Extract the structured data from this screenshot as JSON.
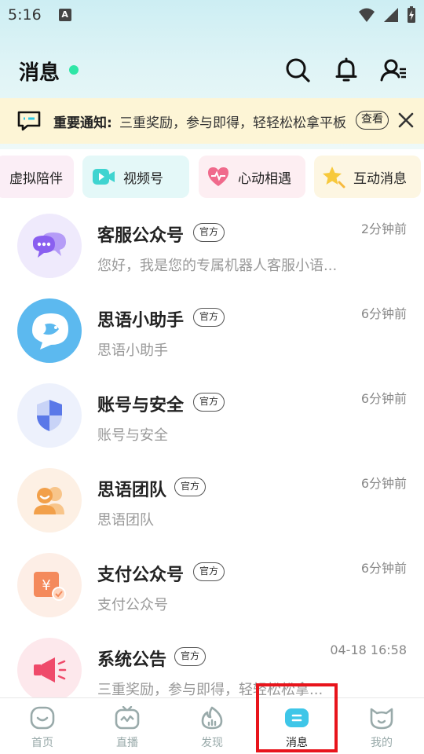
{
  "status_bar": {
    "time": "5:16",
    "badge": "A"
  },
  "header": {
    "title": "消息"
  },
  "notice": {
    "label": "重要通知:",
    "text": "三重奖励，参与即得，轻轻松松拿平板",
    "view_label": "查看"
  },
  "quick_tabs": [
    {
      "label": "虚拟陪伴",
      "icon": "virtual-companion-icon"
    },
    {
      "label": "视频号",
      "icon": "video-channel-icon"
    },
    {
      "label": "心动相遇",
      "icon": "heart-meet-icon"
    },
    {
      "label": "互动消息",
      "icon": "interaction-star-icon"
    }
  ],
  "official_tag": "官方",
  "messages": [
    {
      "title": "客服公众号",
      "time": "2分钟前",
      "preview": "您好，我是您的专属机器人客服小语...",
      "icon": "chat-bubbles-icon",
      "color": "#8a63f0"
    },
    {
      "title": "思语小助手",
      "time": "6分钟前",
      "preview": "思语小助手",
      "icon": "assistant-bird-icon",
      "color": "#5fb8ee"
    },
    {
      "title": "账号与安全",
      "time": "6分钟前",
      "preview": "账号与安全",
      "icon": "shield-icon",
      "color": "#5a78e8"
    },
    {
      "title": "思语团队",
      "time": "6分钟前",
      "preview": "思语团队",
      "icon": "team-icon",
      "color": "#f2a04a"
    },
    {
      "title": "支付公众号",
      "time": "6分钟前",
      "preview": "支付公众号",
      "icon": "payment-yuan-icon",
      "color": "#f48a5c"
    },
    {
      "title": "系统公告",
      "time": "04-18 16:58",
      "preview": "三重奖励，参与即得，轻轻松松拿...",
      "icon": "megaphone-icon",
      "color": "#ef4a6a"
    }
  ],
  "bottom_nav": [
    {
      "label": "首页",
      "icon": "home-icon",
      "active": false
    },
    {
      "label": "直播",
      "icon": "live-tv-icon",
      "active": false
    },
    {
      "label": "发现",
      "icon": "discover-flame-icon",
      "active": false
    },
    {
      "label": "消息",
      "icon": "message-icon",
      "active": true
    },
    {
      "label": "我的",
      "icon": "profile-cat-icon",
      "active": false
    }
  ],
  "colors": {
    "accent": "#3ec6e8",
    "online": "#2ee6a6",
    "highlight": "#e8141b"
  }
}
